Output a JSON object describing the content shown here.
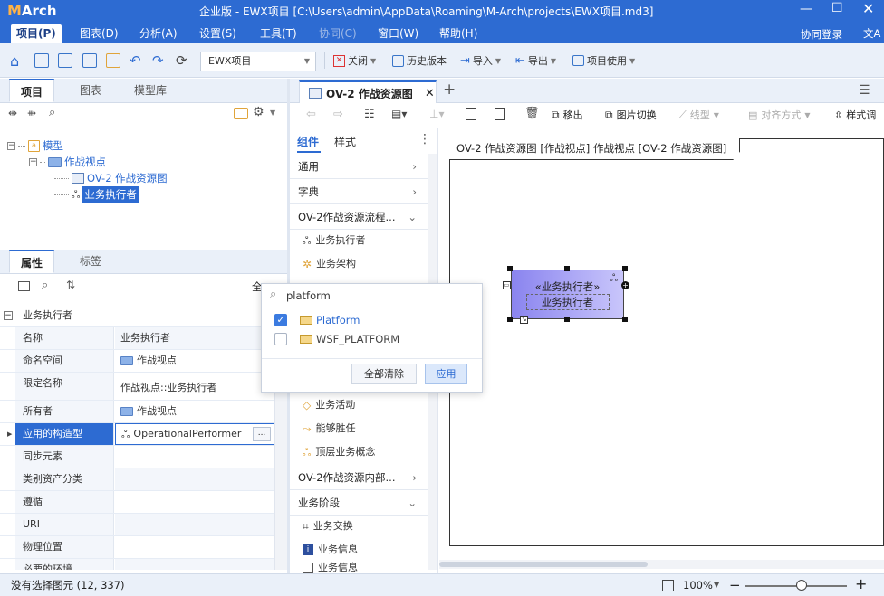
{
  "app": {
    "logo": "Arch",
    "title": "企业版 - EWX项目 [C:\\Users\\admin\\AppData\\Roaming\\M-Arch\\projects\\EWX项目.md3]",
    "login": "协同登录",
    "lang_icon": "文A"
  },
  "menu": [
    {
      "label": "项目(P)"
    },
    {
      "label": "图表(D)"
    },
    {
      "label": "分析(A)"
    },
    {
      "label": "设置(S)"
    },
    {
      "label": "工具(T)"
    },
    {
      "label": "协同(C)"
    },
    {
      "label": "窗口(W)"
    },
    {
      "label": "帮助(H)"
    }
  ],
  "toolbar": {
    "project_combo": "EWX项目",
    "close": "关闭",
    "history": "历史版本",
    "import": "导入",
    "export": "导出",
    "project_use": "项目使用"
  },
  "left_tabs": [
    "项目",
    "图表",
    "模型库"
  ],
  "tree": {
    "root": "模型",
    "folder": "作战视点",
    "diagram": "OV-2 作战资源图",
    "selected": "业务执行者"
  },
  "prop_tabs": [
    "属性",
    "标签"
  ],
  "prop_all": "全",
  "props": {
    "section": "业务执行者",
    "rows": [
      {
        "k": "名称",
        "v": "业务执行者"
      },
      {
        "k": "命名空间",
        "v": "作战视点"
      },
      {
        "k": "限定名称",
        "v": "作战视点::业务执行者"
      },
      {
        "k": "所有者",
        "v": "作战视点"
      },
      {
        "k": "应用的构造型",
        "v": "OperationalPerformer"
      },
      {
        "k": "同步元素",
        "v": ""
      },
      {
        "k": "类别资产分类",
        "v": ""
      },
      {
        "k": "遵循",
        "v": ""
      },
      {
        "k": "URI",
        "v": ""
      },
      {
        "k": "物理位置",
        "v": ""
      },
      {
        "k": "必要的环境",
        "v": ""
      }
    ]
  },
  "doc_tab": "OV-2 作战资源图",
  "diagram_toolbar": {
    "moveout": "移出",
    "img_switch": "图片切换",
    "line_type": "线型",
    "align": "对齐方式",
    "style_adjust": "样式调"
  },
  "palette": {
    "tabs": [
      "组件",
      "样式"
    ],
    "cats_top": [
      "通用",
      "字典",
      "OV-2作战资源流程..."
    ],
    "items_top": [
      "业务执行者",
      "业务架构"
    ],
    "items_mid": [
      "业务活动",
      "能够胜任",
      "顶层业务概念"
    ],
    "cat_inner": "OV-2作战资源内部...",
    "cat_phase": "业务阶段",
    "items_bottom": [
      "业务交换",
      "业务信息",
      "业务信息"
    ]
  },
  "canvas": {
    "frame_title": "OV-2 作战资源图 [作战视点] 作战视点 [OV-2 作战资源图]",
    "element_stereo": "«业务执行者»",
    "element_name": "业务执行者"
  },
  "popup": {
    "search_value": "platform",
    "options": [
      {
        "label": "Platform",
        "checked": true
      },
      {
        "label": "WSF_PLATFORM",
        "checked": false
      }
    ],
    "clear_all": "全部清除",
    "apply": "应用"
  },
  "status": {
    "text": "没有选择图元 (12, 337)",
    "zoom": "100%",
    "zoom_level": 0.55
  },
  "colors": {
    "accent": "#2d6bd2",
    "element_fill": "#a9a6f5"
  }
}
